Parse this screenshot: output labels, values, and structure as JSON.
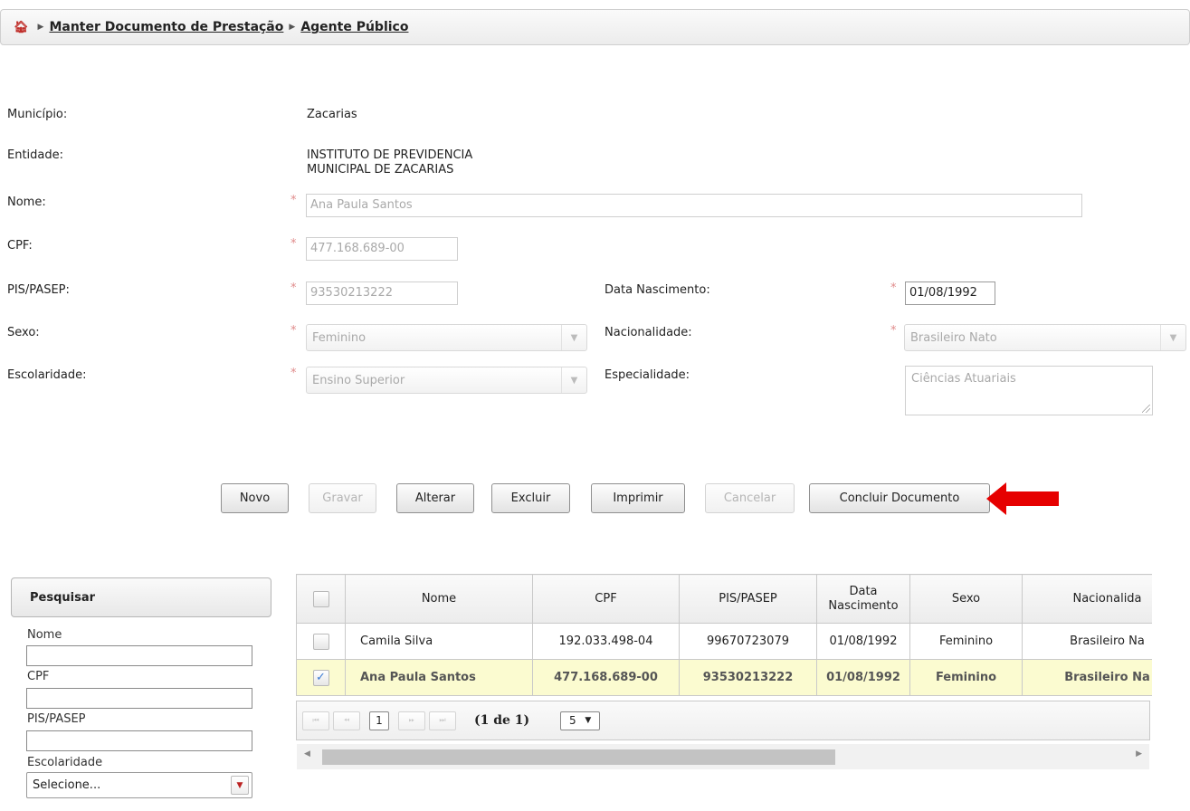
{
  "breadcrumb": {
    "home_icon": "home-icon",
    "items": [
      "Manter Documento de Prestação",
      "Agente Público"
    ]
  },
  "form": {
    "municipio": {
      "label": "Município:",
      "value": "Zacarias"
    },
    "entidade": {
      "label": "Entidade:",
      "value_line1": "INSTITUTO DE PREVIDENCIA",
      "value_line2": "MUNICIPAL DE ZACARIAS"
    },
    "nome": {
      "label": "Nome:",
      "value": "Ana Paula Santos"
    },
    "cpf": {
      "label": "CPF:",
      "value": "477.168.689-00"
    },
    "pis": {
      "label": "PIS/PASEP:",
      "value": "93530213222"
    },
    "data_nascimento": {
      "label": "Data Nascimento:",
      "value": "01/08/1992"
    },
    "sexo": {
      "label": "Sexo:",
      "value": "Feminino"
    },
    "nacionalidade": {
      "label": "Nacionalidade:",
      "value": "Brasileiro Nato"
    },
    "escolaridade": {
      "label": "Escolaridade:",
      "value": "Ensino Superior"
    },
    "especialidade": {
      "label": "Especialidade:",
      "value": "Ciências Atuariais"
    },
    "required_mark": "*"
  },
  "buttons": {
    "novo": "Novo",
    "gravar": "Gravar",
    "alterar": "Alterar",
    "excluir": "Excluir",
    "imprimir": "Imprimir",
    "cancelar": "Cancelar",
    "concluir": "Concluir Documento"
  },
  "annotation_arrow_color": "#e60000",
  "search": {
    "title": "Pesquisar",
    "nome_label": "Nome",
    "cpf_label": "CPF",
    "pis_label": "PIS/PASEP",
    "escolaridade_label": "Escolaridade",
    "escolaridade_value": "Selecione..."
  },
  "grid": {
    "headers": [
      "Nome",
      "CPF",
      "PIS/PASEP",
      "Data Nascimento",
      "Sexo",
      "Nacionalida"
    ],
    "header_data_line1": "Data",
    "header_data_line2": "Nascimento",
    "rows": [
      {
        "checked": false,
        "nome": "Camila Silva",
        "cpf": "192.033.498-04",
        "pis": "99670723079",
        "data": "01/08/1992",
        "sexo": "Feminino",
        "nacionalidade": "Brasileiro Na"
      },
      {
        "checked": true,
        "nome": "Ana Paula Santos",
        "cpf": "477.168.689-00",
        "pis": "93530213222",
        "data": "01/08/1992",
        "sexo": "Feminino",
        "nacionalidade": "Brasileiro Na"
      }
    ],
    "check_mark": "✓"
  },
  "pager": {
    "page": "1",
    "info": "(1 de 1)",
    "rows_per_page": "5"
  }
}
